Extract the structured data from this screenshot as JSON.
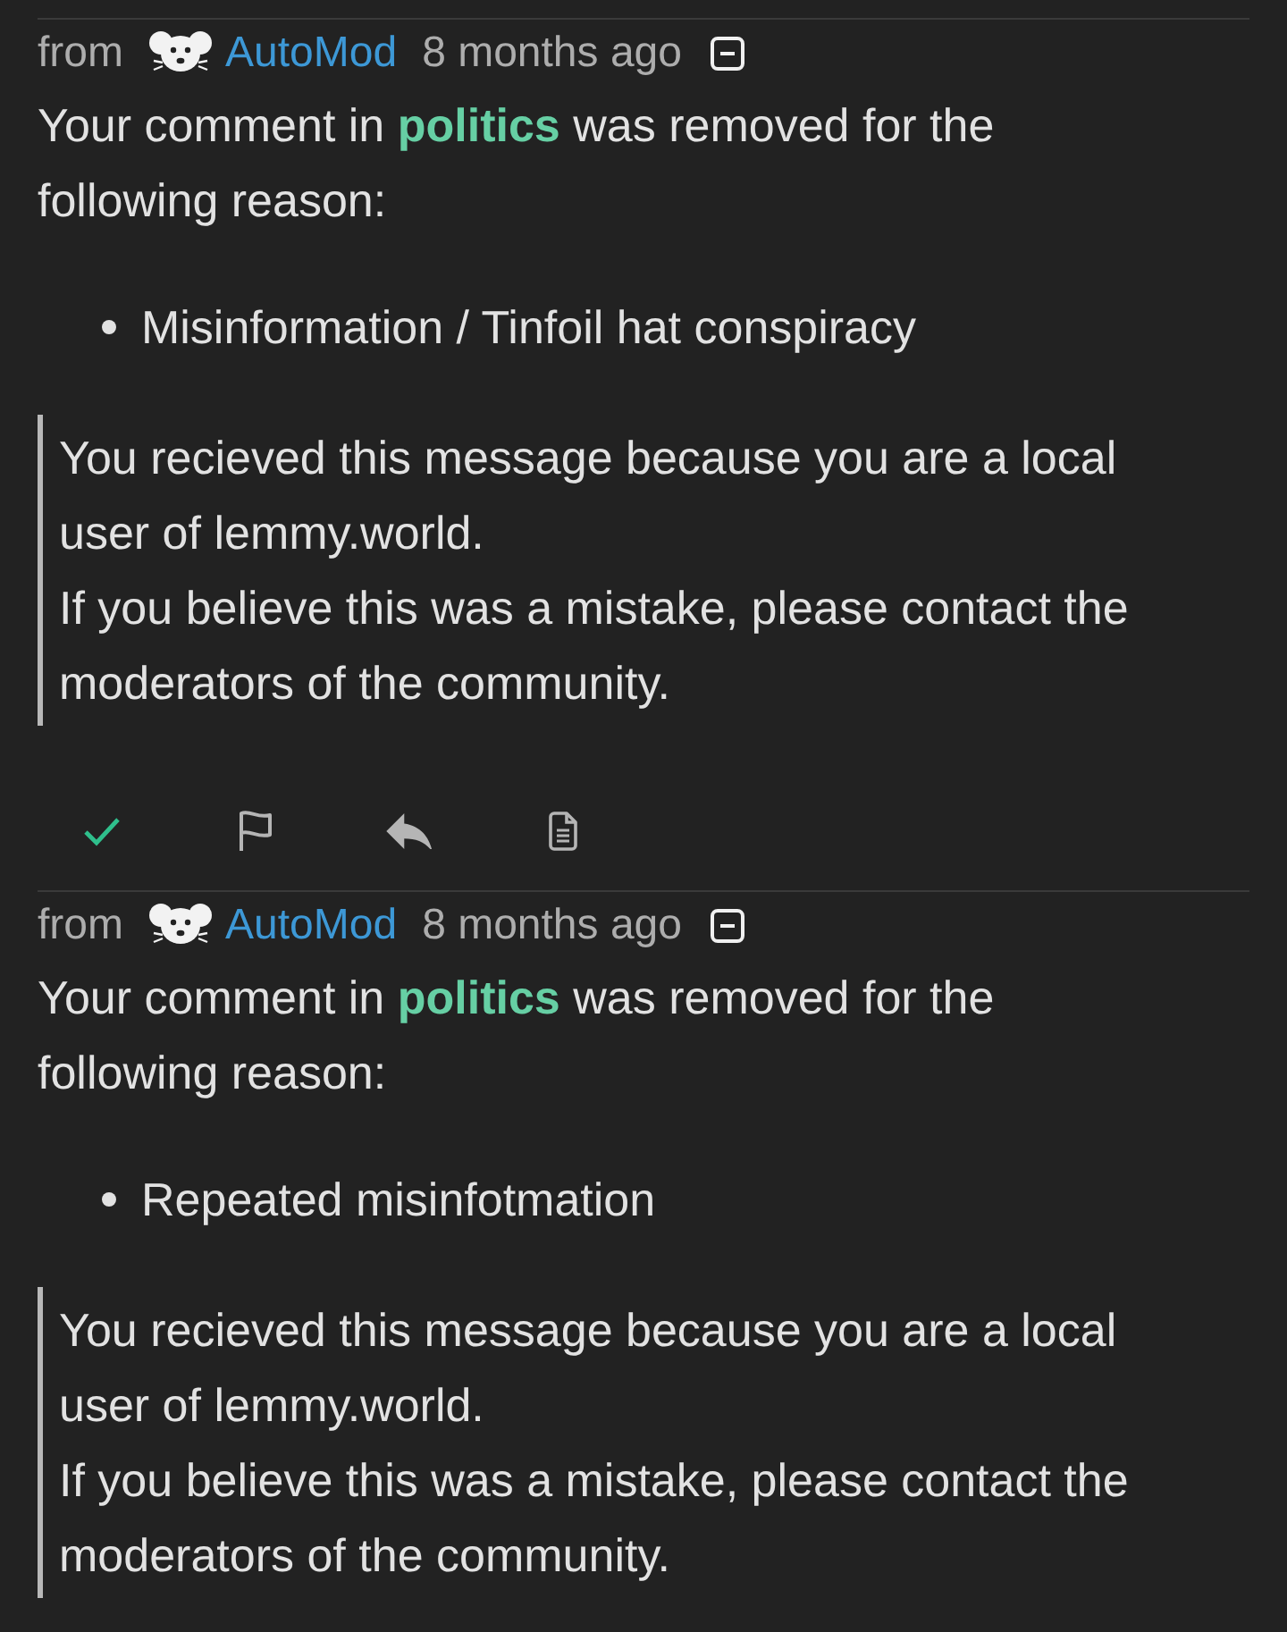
{
  "messages": [
    {
      "header": {
        "prefix": "from",
        "author": "AutoMod",
        "time": "8 months ago",
        "expanded": true
      },
      "body": {
        "before": "Your comment in",
        "community": "politics",
        "after": "was removed for the following reason:"
      },
      "reasons": [
        "Misinformation / Tinfoil hat conspiracy"
      ],
      "quote_lines": [
        "You recieved this message because you are a local user of lemmy.world.",
        "If you believe this was a mistake, please contact the moderators of the community."
      ],
      "actions": [
        {
          "kind": "mark-read",
          "done": true
        },
        {
          "kind": "report"
        },
        {
          "kind": "reply"
        },
        {
          "kind": "view-source"
        }
      ]
    },
    {
      "header": {
        "prefix": "from",
        "author": "AutoMod",
        "time": "8 months ago",
        "expanded": true
      },
      "body": {
        "before": "Your comment in",
        "community": "politics",
        "after": "was removed for the following reason:"
      },
      "reasons": [
        "Repeated misinfotmation"
      ],
      "quote_lines": [
        "You recieved this message because you are a local user of lemmy.world.",
        "If you believe this was a mistake, please contact the moderators of the community."
      ]
    }
  ]
}
